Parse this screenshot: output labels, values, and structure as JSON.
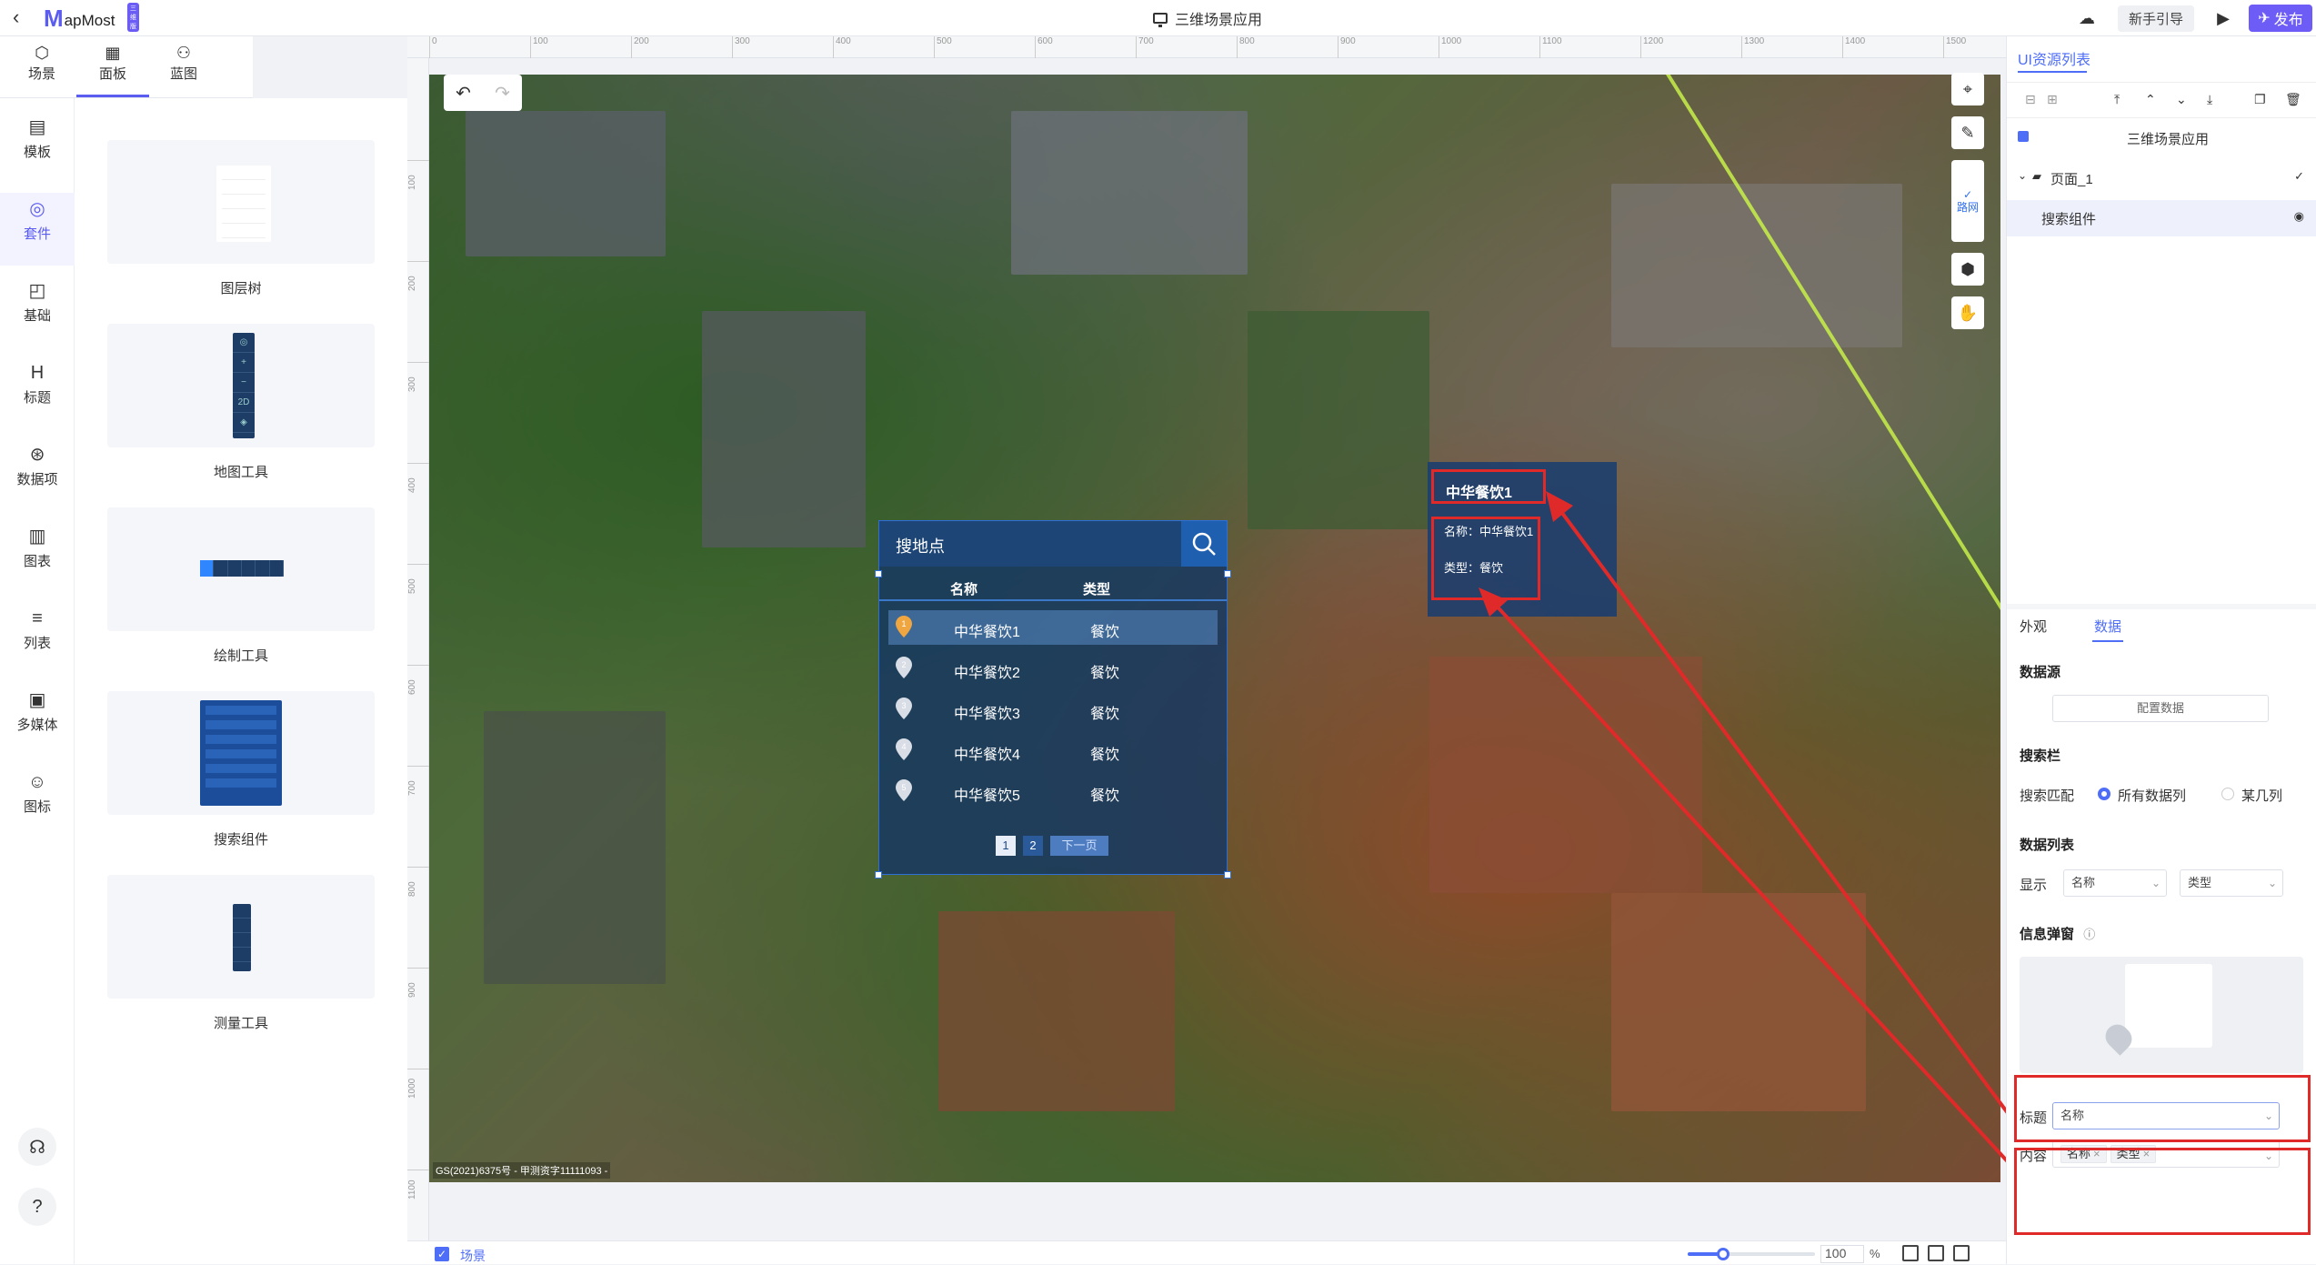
{
  "topbar": {
    "logo_m": "M",
    "logo_text": "apMost",
    "logo_badge": "三维版",
    "app_title": "三维场景应用",
    "guide_label": "新手引导",
    "publish_label": "发布"
  },
  "left_tabs": [
    {
      "label": "场景",
      "icon": "scene-icon"
    },
    {
      "label": "面板",
      "icon": "panel-icon"
    },
    {
      "label": "蓝图",
      "icon": "blueprint-icon"
    }
  ],
  "rail": [
    {
      "label": "模板",
      "icon": "template-icon"
    },
    {
      "label": "套件",
      "icon": "kit-icon"
    },
    {
      "label": "基础",
      "icon": "basic-icon"
    },
    {
      "label": "标题",
      "icon": "heading-icon"
    },
    {
      "label": "数据项",
      "icon": "data-item-icon"
    },
    {
      "label": "图表",
      "icon": "chart-icon"
    },
    {
      "label": "列表",
      "icon": "list-icon"
    },
    {
      "label": "多媒体",
      "icon": "media-icon"
    },
    {
      "label": "图标",
      "icon": "emoji-icon"
    }
  ],
  "gallery": [
    {
      "label": "图层树"
    },
    {
      "label": "地图工具"
    },
    {
      "label": "绘制工具"
    },
    {
      "label": "搜索组件"
    },
    {
      "label": "测量工具"
    }
  ],
  "ruler": {
    "h": [
      "0",
      "100",
      "200",
      "300",
      "400",
      "500",
      "600",
      "700",
      "800",
      "900",
      "1000",
      "1100",
      "1200",
      "1300",
      "1400",
      "1500"
    ],
    "v": [
      "100",
      "200",
      "300",
      "400",
      "500",
      "600",
      "700",
      "800",
      "900",
      "1000",
      "1100"
    ]
  },
  "map_tools": {
    "roam_label": "路网"
  },
  "canvas": {
    "copyright": "GS(2021)6375号 - 甲测资字11111093 -"
  },
  "search_widget": {
    "placeholder": "搜地点",
    "col_name": "名称",
    "col_type": "类型",
    "rows": [
      {
        "num": "1",
        "name": "中华餐饮1",
        "type": "餐饮"
      },
      {
        "num": "2",
        "name": "中华餐饮2",
        "type": "餐饮"
      },
      {
        "num": "3",
        "name": "中华餐饮3",
        "type": "餐饮"
      },
      {
        "num": "4",
        "name": "中华餐饮4",
        "type": "餐饮"
      },
      {
        "num": "5",
        "name": "中华餐饮5",
        "type": "餐饮"
      }
    ],
    "pager": {
      "p1": "1",
      "p2": "2",
      "next": "下一页"
    }
  },
  "popup": {
    "title": "中华餐饮1",
    "line1": "名称：中华餐饮1",
    "line2": "类型：餐饮"
  },
  "bottombar": {
    "scene_label": "场景",
    "zoom_value": "100",
    "zoom_unit": "%",
    "zoom_fraction": 0.28
  },
  "right_panel": {
    "title": "UI资源列表",
    "tree": {
      "root": "三维场景应用",
      "page": "页面_1",
      "component": "搜索组件"
    },
    "tabs": [
      "外观",
      "数据"
    ],
    "datasource_label": "数据源",
    "config_btn": "配置数据",
    "searchbar_label": "搜索栏",
    "match_label": "搜索匹配",
    "match_opt_all": "所有数据列",
    "match_opt_some": "某几列",
    "datalist_label": "数据列表",
    "display_label": "显示",
    "display_sel1": "名称",
    "display_sel2": "类型",
    "popup_label": "信息弹窗",
    "title_label": "标题",
    "title_value": "名称",
    "content_label": "内容",
    "content_tags": [
      "名称",
      "类型"
    ]
  }
}
